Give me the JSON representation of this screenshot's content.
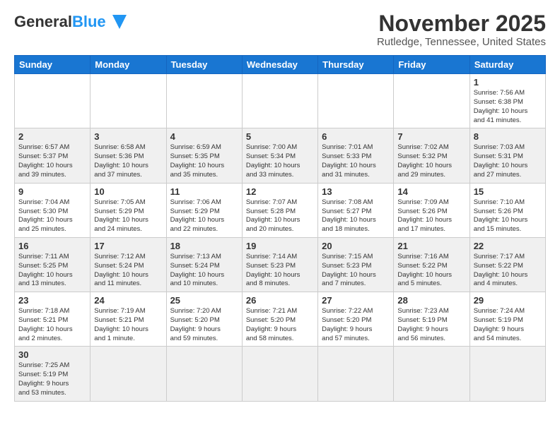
{
  "header": {
    "logo_general": "General",
    "logo_blue": "Blue",
    "month": "November 2025",
    "location": "Rutledge, Tennessee, United States"
  },
  "days_of_week": [
    "Sunday",
    "Monday",
    "Tuesday",
    "Wednesday",
    "Thursday",
    "Friday",
    "Saturday"
  ],
  "weeks": [
    [
      {
        "day": "",
        "info": ""
      },
      {
        "day": "",
        "info": ""
      },
      {
        "day": "",
        "info": ""
      },
      {
        "day": "",
        "info": ""
      },
      {
        "day": "",
        "info": ""
      },
      {
        "day": "",
        "info": ""
      },
      {
        "day": "1",
        "info": "Sunrise: 7:56 AM\nSunset: 6:38 PM\nDaylight: 10 hours\nand 41 minutes."
      }
    ],
    [
      {
        "day": "2",
        "info": "Sunrise: 6:57 AM\nSunset: 5:37 PM\nDaylight: 10 hours\nand 39 minutes."
      },
      {
        "day": "3",
        "info": "Sunrise: 6:58 AM\nSunset: 5:36 PM\nDaylight: 10 hours\nand 37 minutes."
      },
      {
        "day": "4",
        "info": "Sunrise: 6:59 AM\nSunset: 5:35 PM\nDaylight: 10 hours\nand 35 minutes."
      },
      {
        "day": "5",
        "info": "Sunrise: 7:00 AM\nSunset: 5:34 PM\nDaylight: 10 hours\nand 33 minutes."
      },
      {
        "day": "6",
        "info": "Sunrise: 7:01 AM\nSunset: 5:33 PM\nDaylight: 10 hours\nand 31 minutes."
      },
      {
        "day": "7",
        "info": "Sunrise: 7:02 AM\nSunset: 5:32 PM\nDaylight: 10 hours\nand 29 minutes."
      },
      {
        "day": "8",
        "info": "Sunrise: 7:03 AM\nSunset: 5:31 PM\nDaylight: 10 hours\nand 27 minutes."
      }
    ],
    [
      {
        "day": "9",
        "info": "Sunrise: 7:04 AM\nSunset: 5:30 PM\nDaylight: 10 hours\nand 25 minutes."
      },
      {
        "day": "10",
        "info": "Sunrise: 7:05 AM\nSunset: 5:29 PM\nDaylight: 10 hours\nand 24 minutes."
      },
      {
        "day": "11",
        "info": "Sunrise: 7:06 AM\nSunset: 5:29 PM\nDaylight: 10 hours\nand 22 minutes."
      },
      {
        "day": "12",
        "info": "Sunrise: 7:07 AM\nSunset: 5:28 PM\nDaylight: 10 hours\nand 20 minutes."
      },
      {
        "day": "13",
        "info": "Sunrise: 7:08 AM\nSunset: 5:27 PM\nDaylight: 10 hours\nand 18 minutes."
      },
      {
        "day": "14",
        "info": "Sunrise: 7:09 AM\nSunset: 5:26 PM\nDaylight: 10 hours\nand 17 minutes."
      },
      {
        "day": "15",
        "info": "Sunrise: 7:10 AM\nSunset: 5:26 PM\nDaylight: 10 hours\nand 15 minutes."
      }
    ],
    [
      {
        "day": "16",
        "info": "Sunrise: 7:11 AM\nSunset: 5:25 PM\nDaylight: 10 hours\nand 13 minutes."
      },
      {
        "day": "17",
        "info": "Sunrise: 7:12 AM\nSunset: 5:24 PM\nDaylight: 10 hours\nand 11 minutes."
      },
      {
        "day": "18",
        "info": "Sunrise: 7:13 AM\nSunset: 5:24 PM\nDaylight: 10 hours\nand 10 minutes."
      },
      {
        "day": "19",
        "info": "Sunrise: 7:14 AM\nSunset: 5:23 PM\nDaylight: 10 hours\nand 8 minutes."
      },
      {
        "day": "20",
        "info": "Sunrise: 7:15 AM\nSunset: 5:23 PM\nDaylight: 10 hours\nand 7 minutes."
      },
      {
        "day": "21",
        "info": "Sunrise: 7:16 AM\nSunset: 5:22 PM\nDaylight: 10 hours\nand 5 minutes."
      },
      {
        "day": "22",
        "info": "Sunrise: 7:17 AM\nSunset: 5:22 PM\nDaylight: 10 hours\nand 4 minutes."
      }
    ],
    [
      {
        "day": "23",
        "info": "Sunrise: 7:18 AM\nSunset: 5:21 PM\nDaylight: 10 hours\nand 2 minutes."
      },
      {
        "day": "24",
        "info": "Sunrise: 7:19 AM\nSunset: 5:21 PM\nDaylight: 10 hours\nand 1 minute."
      },
      {
        "day": "25",
        "info": "Sunrise: 7:20 AM\nSunset: 5:20 PM\nDaylight: 9 hours\nand 59 minutes."
      },
      {
        "day": "26",
        "info": "Sunrise: 7:21 AM\nSunset: 5:20 PM\nDaylight: 9 hours\nand 58 minutes."
      },
      {
        "day": "27",
        "info": "Sunrise: 7:22 AM\nSunset: 5:20 PM\nDaylight: 9 hours\nand 57 minutes."
      },
      {
        "day": "28",
        "info": "Sunrise: 7:23 AM\nSunset: 5:19 PM\nDaylight: 9 hours\nand 56 minutes."
      },
      {
        "day": "29",
        "info": "Sunrise: 7:24 AM\nSunset: 5:19 PM\nDaylight: 9 hours\nand 54 minutes."
      }
    ],
    [
      {
        "day": "30",
        "info": "Sunrise: 7:25 AM\nSunset: 5:19 PM\nDaylight: 9 hours\nand 53 minutes."
      },
      {
        "day": "",
        "info": ""
      },
      {
        "day": "",
        "info": ""
      },
      {
        "day": "",
        "info": ""
      },
      {
        "day": "",
        "info": ""
      },
      {
        "day": "",
        "info": ""
      },
      {
        "day": "",
        "info": ""
      }
    ]
  ]
}
